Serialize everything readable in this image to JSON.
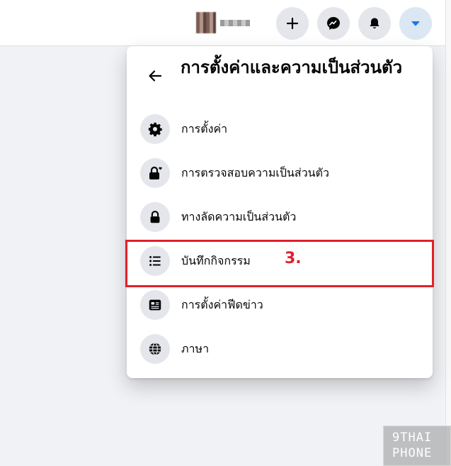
{
  "menu": {
    "title": "การตั้งค่าและความเป็นส่วนตัว",
    "items": [
      {
        "label": "การตั้งค่า",
        "icon": "gear-icon"
      },
      {
        "label": "การตรวจสอบความเป็นส่วนตัว",
        "icon": "lock-heart-icon"
      },
      {
        "label": "ทางลัดความเป็นส่วนตัว",
        "icon": "lock-icon"
      },
      {
        "label": "บันทึกกิจกรรม",
        "icon": "list-icon"
      },
      {
        "label": "การตั้งค่าฟีดข่าว",
        "icon": "news-feed-icon"
      },
      {
        "label": "ภาษา",
        "icon": "globe-icon"
      }
    ]
  },
  "annotation": {
    "step_label": "3.",
    "color": "#e0202c"
  },
  "topbar": {
    "buttons": [
      "plus-icon",
      "messenger-icon",
      "bell-icon",
      "caret-down-icon"
    ],
    "accent": "#1877f2"
  },
  "watermark": {
    "line1": "9THAI",
    "line2": "PHONE"
  }
}
